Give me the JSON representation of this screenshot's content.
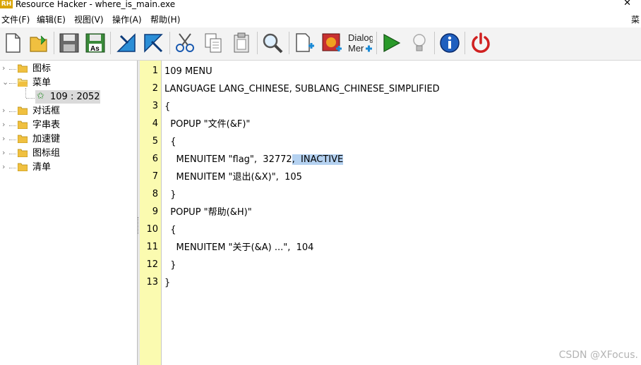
{
  "window": {
    "title": "Resource Hacker - where_is_main.exe",
    "app_logo": "RH",
    "close_glyph": "✕"
  },
  "menu": {
    "items": [
      "文件(F)",
      "编辑(E)",
      "视图(V)",
      "操作(A)",
      "帮助(H)"
    ],
    "right_item": "菜"
  },
  "toolbar": {
    "icons": [
      "new-file-icon",
      "open-folder-icon",
      "save-icon",
      "save-as-icon",
      "compile-icon",
      "navigate-icon",
      "cut-icon",
      "copy-icon",
      "paste-icon",
      "find-icon",
      "add-resource-icon",
      "add-image-icon",
      "dialog-merger-icon",
      "run-script-icon",
      "hint-bulb-icon",
      "about-info-icon",
      "exit-power-icon"
    ],
    "save_as_text": "As",
    "dialog_line1": "Dialog",
    "dialog_line2": "Mer"
  },
  "tree": {
    "items": [
      "图标",
      "菜单",
      "对话框",
      "字串表",
      "加速键",
      "图标组",
      "清单"
    ],
    "expanded_index": 1,
    "child": "109 : 2052"
  },
  "editor": {
    "line_numbers": [
      "1",
      "2",
      "3",
      "4",
      "5",
      "6",
      "7",
      "8",
      "9",
      "10",
      "11",
      "12",
      "13"
    ],
    "lines": [
      "109 MENU",
      "LANGUAGE LANG_CHINESE, SUBLANG_CHINESE_SIMPLIFIED",
      "{",
      "  POPUP \"文件(&F)\"",
      "  {",
      "    MENUITEM \"flag\",  32772",
      "    MENUITEM \"退出(&X)\",  105",
      "  }",
      "  POPUP \"帮助(&H)\"",
      "  {",
      "    MENUITEM \"关于(&A) ...\",  104",
      "  }",
      "}"
    ],
    "selection": ",  INACTIVE",
    "selection_line_index": 5
  },
  "watermark": "CSDN @XFocus.",
  "colors": {
    "gutter": "#fbfbb0",
    "selection": "#b4d1f0",
    "folder": "#f0c040",
    "run": "#2a9a2a",
    "power": "#d02020",
    "info": "#1f5fbf"
  }
}
